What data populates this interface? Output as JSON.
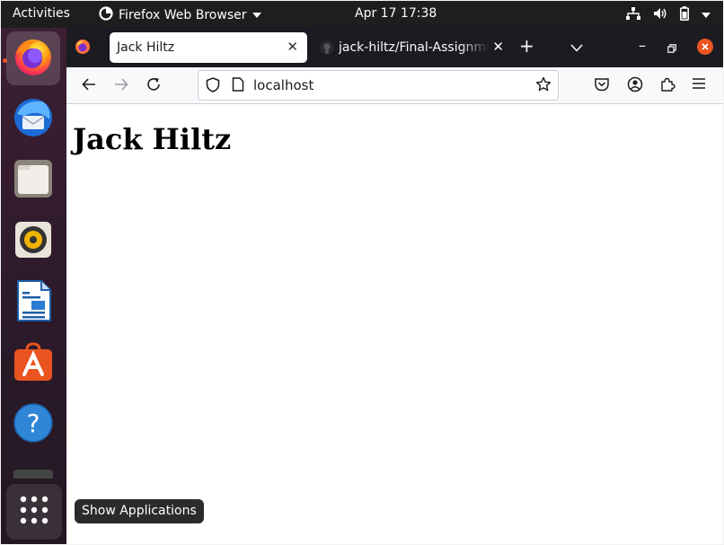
{
  "topbar": {
    "activities": "Activities",
    "app_name": "Firefox Web Browser",
    "clock": "Apr 17  17:38",
    "tray_icons": [
      "network-icon",
      "volume-icon",
      "battery-icon",
      "system-menu-icon"
    ]
  },
  "dock": {
    "items": [
      "firefox-icon",
      "thunderbird-icon",
      "files-icon",
      "rhythmbox-icon",
      "libreoffice-writer-icon",
      "ubuntu-software-icon",
      "help-icon"
    ],
    "active": "firefox-icon",
    "show_apps_tooltip": "Show Applications"
  },
  "browser": {
    "tabs": [
      {
        "title": "Jack Hiltz",
        "active": true
      },
      {
        "title": "jack-hiltz/Final-Assignment",
        "active": false
      }
    ],
    "url": "localhost"
  },
  "page": {
    "heading": "Jack Hiltz"
  },
  "colors": {
    "topbar": "#1e1e1e",
    "tabbar": "#1c1b22",
    "ubuntu_orange": "#e95420"
  }
}
